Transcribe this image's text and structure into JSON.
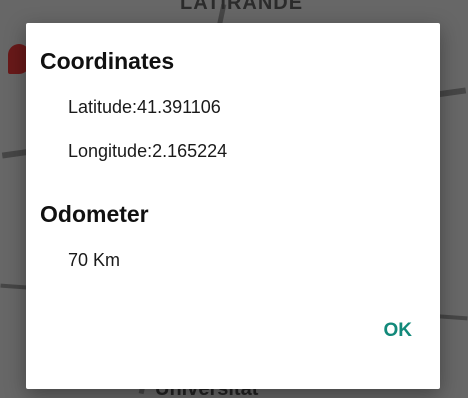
{
  "map": {
    "top_label": "LATIRANDE",
    "bottom_label": "Universitat"
  },
  "dialog": {
    "coordinates_title": "Coordinates",
    "latitude_text": "Latitude:41.391106",
    "longitude_text": "Longitude:2.165224",
    "odometer_title": "Odometer",
    "odometer_value": "70 Km",
    "ok_label": "OK"
  },
  "colors": {
    "accent": "#12897a",
    "dialog_bg": "#ffffff",
    "scrim": "#8a8a8a"
  }
}
